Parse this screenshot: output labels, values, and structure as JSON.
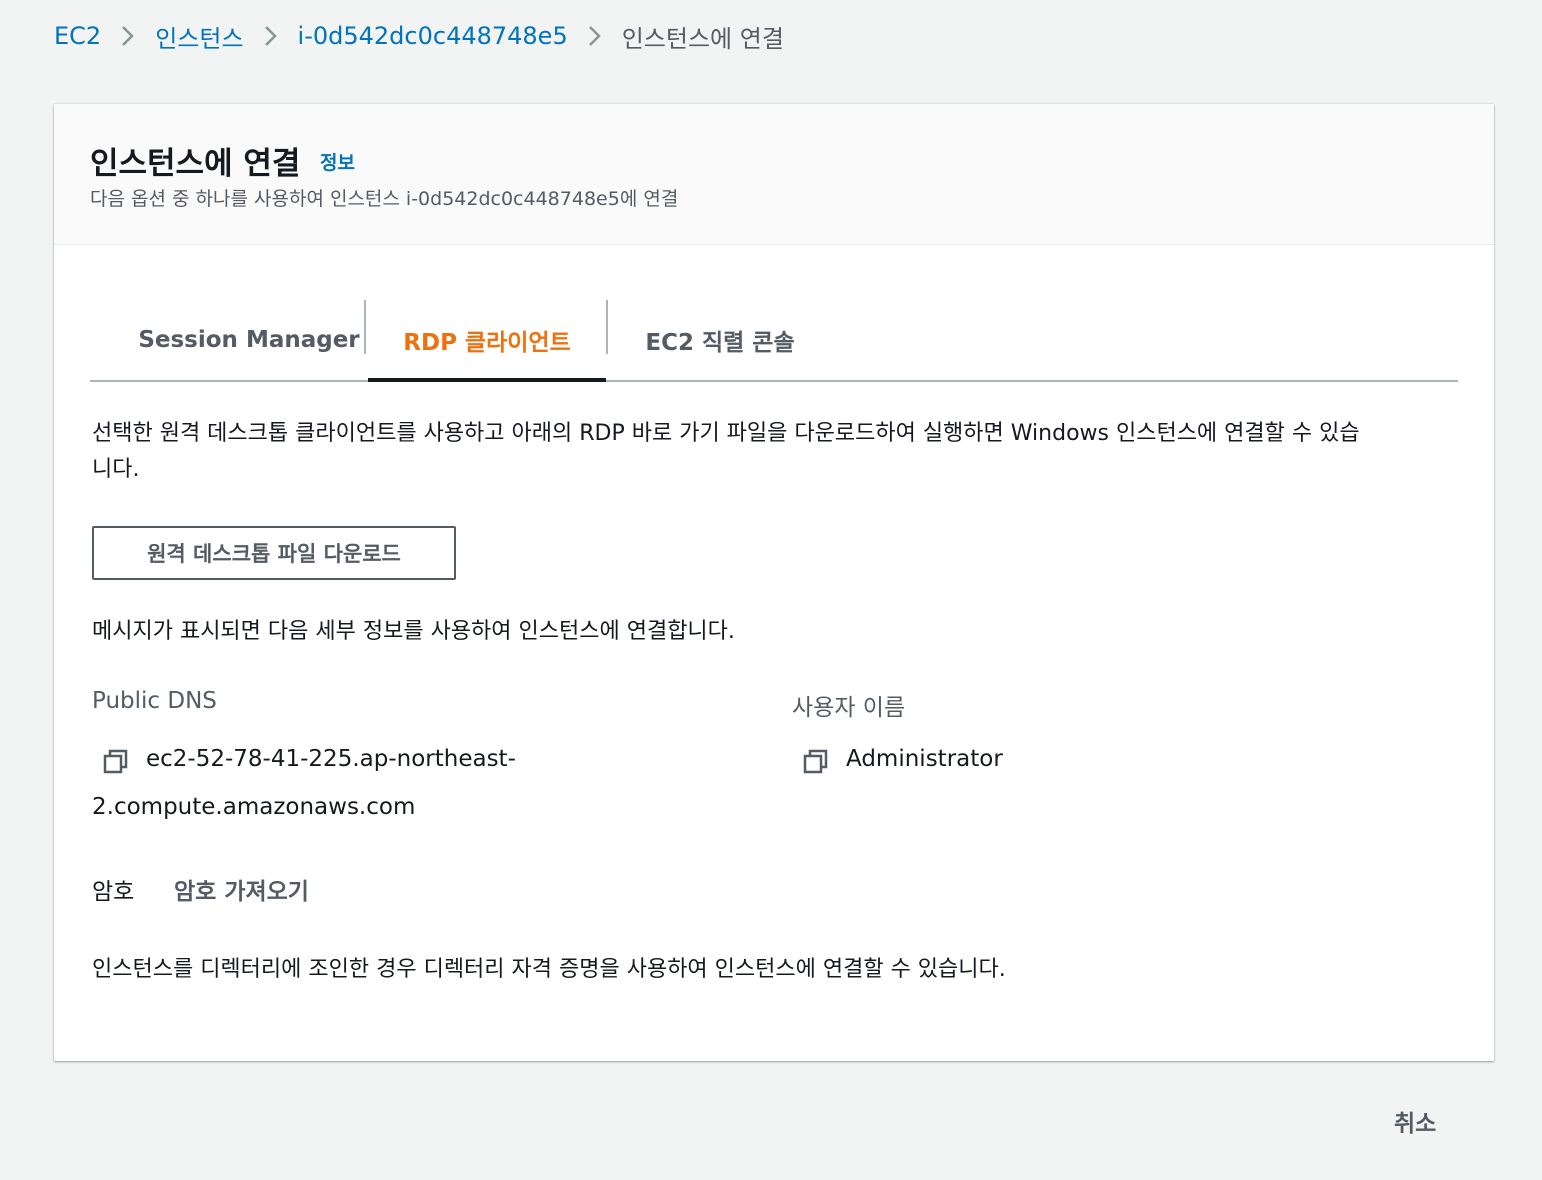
{
  "breadcrumb": {
    "items": [
      {
        "label": "EC2",
        "link": true
      },
      {
        "label": "인스턴스",
        "link": true
      },
      {
        "label": "i-0d542dc0c448748e5",
        "link": true
      },
      {
        "label": "인스턴스에 연결",
        "link": false
      }
    ]
  },
  "panel": {
    "title": "인스턴스에 연결",
    "info_link": "정보",
    "description": "다음 옵션 중 하나를 사용하여 인스턴스 i-0d542dc0c448748e5에 연결"
  },
  "tabs": [
    {
      "label": "Session Manager",
      "active": false
    },
    {
      "label": "RDP 클라이언트",
      "active": true
    },
    {
      "label": "EC2 직렬 콘솔",
      "active": false
    }
  ],
  "rdp": {
    "intro_line1": "선택한 원격 데스크톱 클라이언트를 사용하고 아래의 RDP 바로 가기 파일을 다운로드하여 실행하면 Windows 인스턴스에 연결할 수 있습",
    "intro_line2": "니다.",
    "download_button": "원격 데스크톱 파일 다운로드",
    "prompt_text": "메시지가 표시되면 다음 세부 정보를 사용하여 인스턴스에 연결합니다.",
    "public_dns_label": "Public DNS",
    "public_dns_line1": "ec2-52-78-41-225.ap-northeast-",
    "public_dns_line2": "2.compute.amazonaws.com",
    "username_label": "사용자 이름",
    "username_value": "Administrator",
    "password_label": "암호",
    "get_password_link": "암호 가져오기",
    "directory_note": "인스턴스를 디렉터리에 조인한 경우 디렉터리 자격 증명을 사용하여 인스턴스에 연결할 수 있습니다."
  },
  "footer": {
    "cancel_label": "취소"
  },
  "icons": {
    "breadcrumb_separator": "chevron-right-icon",
    "copy": "copy-icon"
  },
  "colors": {
    "link": "#0073bb",
    "active_tab": "#ec7211",
    "background": "#f2f3f3"
  }
}
